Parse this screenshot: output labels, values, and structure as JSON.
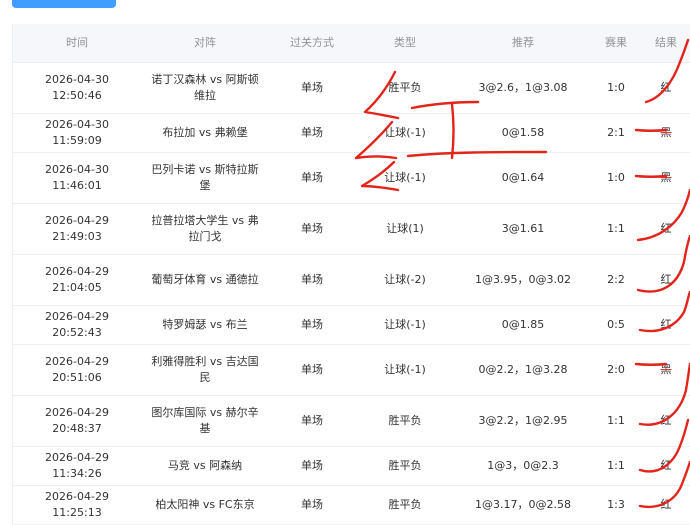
{
  "colors": {
    "accent": "#409eff",
    "ink": "#e3241b",
    "header_bg": "#f5f7fa"
  },
  "header": {
    "time": "时间",
    "match": "对阵",
    "type": "过关方式",
    "kind": "类型",
    "rec": "推荐",
    "score": "赛果",
    "result": "结果"
  },
  "rows": [
    {
      "time": "2026-04-30 12:50:46",
      "match": "诺丁汉森林 vs 阿斯顿维拉",
      "type": "单场",
      "kind": "胜平负",
      "rec": "3@2.6，1@3.08",
      "score": "1:0",
      "result": "红"
    },
    {
      "time": "2026-04-30 11:59:09",
      "match": "布拉加 vs 弗赖堡",
      "type": "单场",
      "kind": "让球(-1)",
      "rec": "0@1.58",
      "score": "2:1",
      "result": "黑"
    },
    {
      "time": "2026-04-30 11:46:01",
      "match": "巴列卡诺 vs 斯特拉斯堡",
      "type": "单场",
      "kind": "让球(-1)",
      "rec": "0@1.64",
      "score": "1:0",
      "result": "黑"
    },
    {
      "time": "2026-04-29 21:49:03",
      "match": "拉普拉塔大学生 vs 弗拉门戈",
      "type": "单场",
      "kind": "让球(1)",
      "rec": "3@1.61",
      "score": "1:1",
      "result": "红"
    },
    {
      "time": "2026-04-29 21:04:05",
      "match": "葡萄牙体育 vs 通德拉",
      "type": "单场",
      "kind": "让球(-2)",
      "rec": "1@3.95，0@3.02",
      "score": "2:2",
      "result": "红"
    },
    {
      "time": "2026-04-29 20:52:43",
      "match": "特罗姆瑟 vs 布兰",
      "type": "单场",
      "kind": "让球(-1)",
      "rec": "0@1.85",
      "score": "0:5",
      "result": "红"
    },
    {
      "time": "2026-04-29 20:51:06",
      "match": "利雅得胜利 vs 吉达国民",
      "type": "单场",
      "kind": "让球(-1)",
      "rec": "0@2.2，1@3.28",
      "score": "2:0",
      "result": "黑"
    },
    {
      "time": "2026-04-29 20:48:37",
      "match": "图尔库国际 vs 赫尔辛基",
      "type": "单场",
      "kind": "胜平负",
      "rec": "3@2.2，1@2.95",
      "score": "1:1",
      "result": "红"
    },
    {
      "time": "2026-04-29 11:34:26",
      "match": "马竞 vs 阿森纳",
      "type": "单场",
      "kind": "胜平负",
      "rec": "1@3，0@2.3",
      "score": "1:1",
      "result": "红"
    },
    {
      "time": "2026-04-29 11:25:13",
      "match": "柏太阳神 vs FC东京",
      "type": "单场",
      "kind": "胜平负",
      "rec": "1@3.17，0@2.58",
      "score": "1:3",
      "result": "红"
    }
  ]
}
